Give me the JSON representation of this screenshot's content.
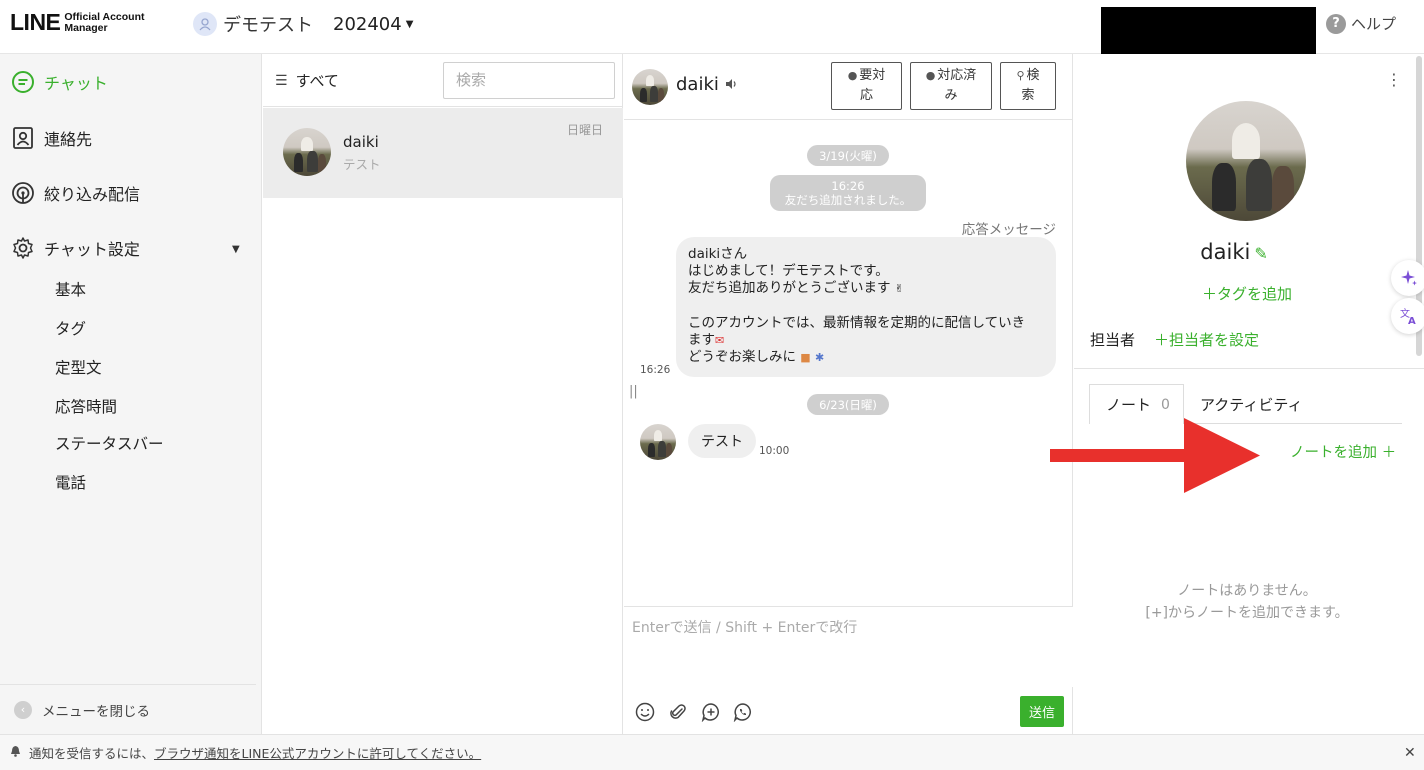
{
  "header": {
    "logo_main": "LINE",
    "logo_sub_1": "Official Account",
    "logo_sub_2": "Manager",
    "account_name": "デモテスト",
    "account_period": "202404",
    "help_label": "ヘルプ"
  },
  "sidebar": {
    "items": [
      {
        "label": "チャット",
        "icon": "chat-icon",
        "active": true
      },
      {
        "label": "連絡先",
        "icon": "contacts-icon"
      },
      {
        "label": "絞り込み配信",
        "icon": "broadcast-icon"
      },
      {
        "label": "チャット設定",
        "icon": "gear-icon"
      }
    ],
    "sub_items": [
      "基本",
      "タグ",
      "定型文",
      "応答時間",
      "ステータスバー",
      "電話"
    ],
    "close_menu": "メニューを閉じる"
  },
  "chat_list": {
    "filter_label": "すべて",
    "search_placeholder": "検索",
    "rows": [
      {
        "name": "daiki",
        "preview": "テスト",
        "date": "日曜日"
      }
    ]
  },
  "chat": {
    "contact_name": "daiki",
    "buttons": {
      "needs_action_1": "要対",
      "needs_action_2": "応",
      "done_1": "対応済",
      "done_2": "み",
      "search_1": "検",
      "search_2": "索"
    },
    "date_1": "3/19(火曜)",
    "system_time": "16:26",
    "system_text": "友だち追加されました。",
    "auto_reply_label": "応答メッセージ",
    "auto_reply_lines": [
      "daikiさん",
      "はじめまして！デモテストです。",
      "友だち追加ありがとうございます",
      "",
      "このアカウントでは、最新情報を定期的に配信していき",
      "ます",
      "どうぞお楽しみに"
    ],
    "auto_reply_time": "16:26",
    "date_2": "6/23(日曜)",
    "incoming_text": "テスト",
    "incoming_time": "10:00",
    "composer_placeholder": "Enterで送信 / Shift + Enterで改行",
    "send_label": "送信"
  },
  "profile": {
    "name": "daiki",
    "add_tag": "＋タグを追加",
    "assignee_label": "担当者",
    "assignee_set": "＋担当者を設定",
    "tab_note": "ノート",
    "tab_note_count": "0",
    "tab_activity": "アクティビティ",
    "add_note": "ノートを追加 ＋",
    "empty_line_1": "ノートはありません。",
    "empty_line_2": "[+]からノートを追加できます。"
  },
  "notice": {
    "text": "通知を受信するには、",
    "link": "ブラウザ通知をLINE公式アカウントに許可してください。"
  },
  "colors": {
    "accent_green": "#3ab02d",
    "annotation_red": "#e8302c"
  }
}
